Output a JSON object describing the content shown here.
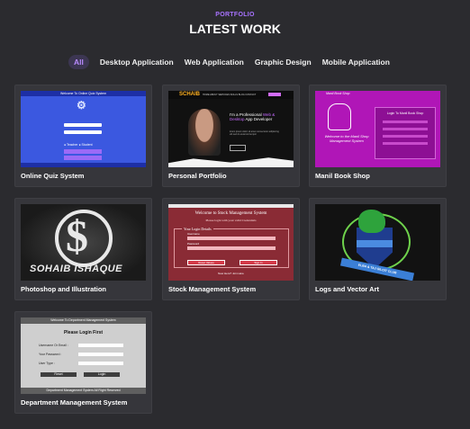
{
  "header": {
    "eyebrow": "PORTFOLIO",
    "title": "LATEST WORK"
  },
  "filters": [
    {
      "label": "All",
      "active": true
    },
    {
      "label": "Desktop Application",
      "active": false
    },
    {
      "label": "Web Application",
      "active": false
    },
    {
      "label": "Graphic Design",
      "active": false
    },
    {
      "label": "Mobile Application",
      "active": false
    }
  ],
  "projects": [
    {
      "title": "Online Quiz System",
      "thumb": "quiz-screenshot"
    },
    {
      "title": "Personal Portfolio",
      "thumb": "portfolio-screenshot"
    },
    {
      "title": "Manil Book Shop",
      "thumb": "bookshop-screenshot"
    },
    {
      "title": "Photoshop and Illustration",
      "thumb": "logo-artwork"
    },
    {
      "title": "Stock Management System",
      "thumb": "stock-screenshot"
    },
    {
      "title": "Logs and Vector Art",
      "thumb": "vector-logo"
    },
    {
      "title": "Department Management System",
      "thumb": "dept-screenshot"
    }
  ],
  "thumbs": {
    "quiz": {
      "bar": "Welcome To Online Quiz System"
    },
    "portfolio": {
      "brand": "SCHAIB",
      "headline_pre": "I'm a Professional",
      "headline_em": "Web & Desktop",
      "headline_post": "App Developer",
      "cta": "Resume"
    },
    "book": {
      "title": "Manil Book Shop",
      "welcome": "Welcome to the Manil Shop Management System",
      "login": "Login To Manil Book Shop"
    },
    "ps": {
      "name": "SOHAIB ISHAQUE"
    },
    "stock": {
      "heading": "Welcome to Stock Management System",
      "sub": "Please login with your valid Credentials",
      "legend": "Your Login Details",
      "user": "Username",
      "pass": "Password",
      "reset": "Reset Values",
      "signin": "Sign In",
      "footer": "New Here? Join Here"
    },
    "logs": {
      "banner": "ELBA & TAJ GILGIT CLUB"
    },
    "dept": {
      "bar": "Welcome To Department Management System",
      "heading": "Please Login First",
      "email": "Username Or Email :",
      "password": "Your Password :",
      "usertype": "User Type :",
      "reset": "Reset",
      "login": "Login",
      "footer": "Department Management System All Right Reserved"
    }
  },
  "colors": {
    "background": "#2b2b2f",
    "accent": "#a873ff",
    "card": "#36363b"
  }
}
